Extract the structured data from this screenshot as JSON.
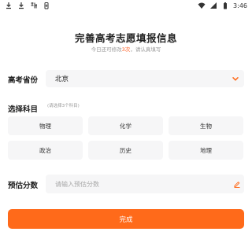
{
  "status_bar": {
    "time": "3:46",
    "icons": [
      "download-icon",
      "download-icon",
      "app-icon",
      "battery-saver-icon",
      "wifi-icon",
      "signal-icon",
      "battery-icon"
    ]
  },
  "header": {
    "title": "完善高考志愿填报信息",
    "subtitle_prefix": "今日还可修改",
    "subtitle_count": "3次",
    "subtitle_suffix": "，请认真填写"
  },
  "province": {
    "label": "高考省份",
    "value": "北京",
    "icon": "chevron-down-icon"
  },
  "subjects": {
    "title": "选择科目",
    "hint": "(请选择3个科目)",
    "options": [
      "物理",
      "化学",
      "生物",
      "政治",
      "历史",
      "地理"
    ]
  },
  "score": {
    "label": "预估分数",
    "value": "",
    "placeholder": "请输入预估分数",
    "icon": "edit-icon"
  },
  "actions": {
    "submit_label": "完成"
  },
  "colors": {
    "accent": "#ff6a1a",
    "highlight": "#ff5a1f",
    "field_bg": "#f6f6f7"
  }
}
